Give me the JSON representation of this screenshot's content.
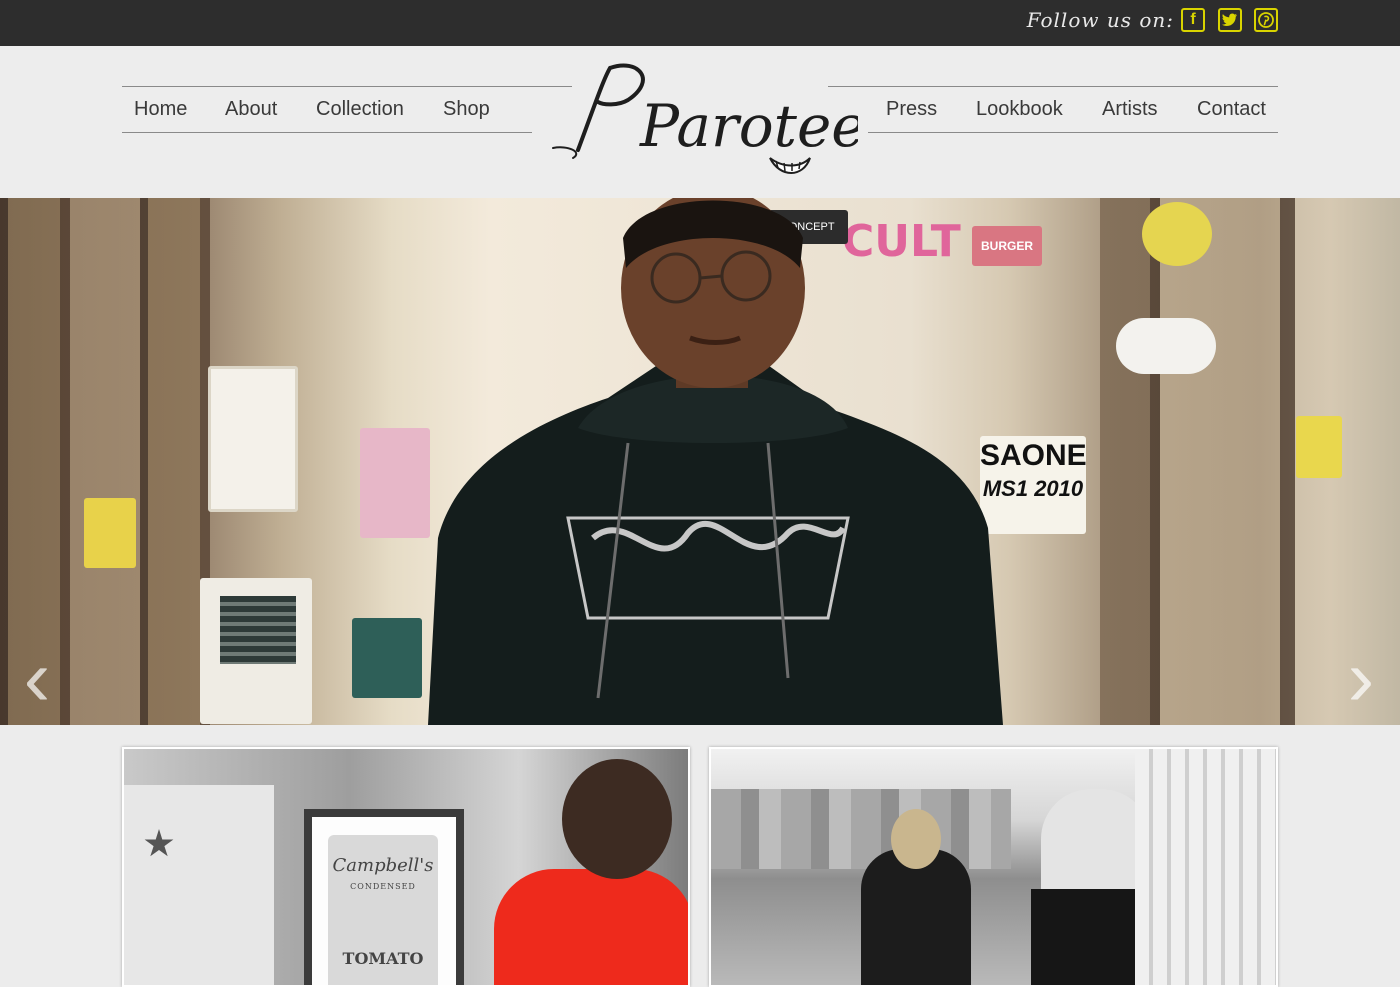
{
  "topbar": {
    "follow_text": "Follow us on:",
    "social": [
      {
        "name": "facebook",
        "glyph": "f"
      },
      {
        "name": "twitter",
        "glyph": "t"
      },
      {
        "name": "pinterest",
        "glyph": "p"
      }
    ]
  },
  "brand": {
    "logo_text": "Parotees"
  },
  "nav": {
    "left": [
      "Home",
      "About",
      "Collection",
      "Shop"
    ],
    "right": [
      "Press",
      "Lookbook",
      "Artists",
      "Contact"
    ]
  },
  "hero": {
    "prev_glyph": "‹",
    "next_glyph": "›",
    "sticker_texts": [
      "SAONE",
      "MS1 2010",
      "CULT",
      "KONCEPT",
      "BURGER"
    ]
  },
  "thumbs": [
    {
      "name": "thumb-red-shirt",
      "can_text": "Campbell's",
      "can_sub": "CONDENSED",
      "can_flavor": "TOMATO"
    },
    {
      "name": "thumb-rooftop"
    }
  ],
  "colors": {
    "topbar_bg": "#2d2d2d",
    "social_accent": "#d9d400",
    "nav_text": "#3a3a3a",
    "page_bg": "#ececec"
  }
}
